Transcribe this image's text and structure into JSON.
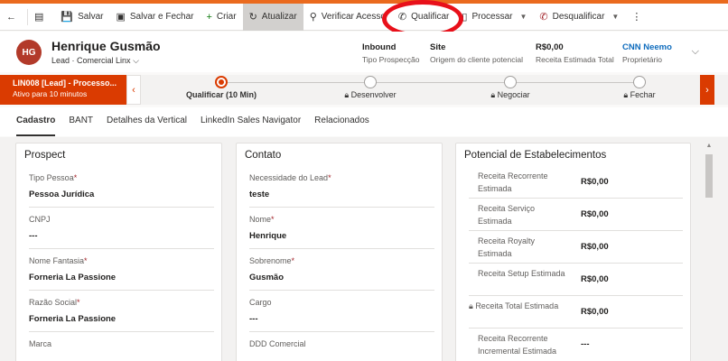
{
  "toolbar": {
    "save": "Salvar",
    "save_close": "Salvar e Fechar",
    "create": "Criar",
    "refresh": "Atualizar",
    "verify_access": "Verificar Acesso",
    "qualify": "Qualificar",
    "process": "Processar",
    "disqualify": "Desqualificar"
  },
  "header": {
    "avatar_initials": "HG",
    "name": "Henrique Gusmão",
    "entity": "Lead",
    "form": "Comercial Linx",
    "fields": [
      {
        "value": "Inbound",
        "label": "Tipo Prospecção"
      },
      {
        "value": "Site",
        "label": "Origem do cliente potencial"
      },
      {
        "value": "R$0,00",
        "label": "Receita Estimada Total"
      },
      {
        "value": "CNN Neemo",
        "label": "Proprietário"
      }
    ]
  },
  "process": {
    "name": "LIN008 [Lead] - Processo...",
    "status": "Ativo para 10 minutos",
    "stages": [
      "Qualificar  (10 Min)",
      "Desenvolver",
      "Negociar",
      "Fechar"
    ]
  },
  "tabs": [
    "Cadastro",
    "BANT",
    "Detalhes da Vertical",
    "LinkedIn Sales Navigator",
    "Relacionados"
  ],
  "prospect": {
    "title": "Prospect",
    "fields": [
      {
        "label": "Tipo Pessoa",
        "required": "*",
        "value": "Pessoa Jurídica"
      },
      {
        "label": "CNPJ",
        "required": "",
        "value": "---"
      },
      {
        "label": "Nome Fantasia",
        "required": "*",
        "value": "Forneria La Passione"
      },
      {
        "label": "Razão Social",
        "required": "*",
        "value": "Forneria La Passione"
      },
      {
        "label": "Marca",
        "required": "",
        "value": ""
      }
    ]
  },
  "contato": {
    "title": "Contato",
    "fields": [
      {
        "label": "Necessidade do Lead",
        "required": "*",
        "value": "teste"
      },
      {
        "label": "Nome",
        "required": "*",
        "value": "Henrique"
      },
      {
        "label": "Sobrenome",
        "required": "*",
        "value": "Gusmão"
      },
      {
        "label": "Cargo",
        "required": "",
        "value": "---"
      },
      {
        "label": "DDD Comercial",
        "required": "",
        "value": ""
      }
    ]
  },
  "potencial": {
    "title": "Potencial de Estabelecimentos",
    "fields": [
      {
        "label": "Receita Recorrente Estimada",
        "value": "R$0,00"
      },
      {
        "label": "Receita Serviço Estimada",
        "value": "R$0,00"
      },
      {
        "label": "Receita Royalty Estimada",
        "value": "R$0,00"
      },
      {
        "label": "Receita Setup Estimada",
        "value": "R$0,00"
      },
      {
        "label": "Receita Total Estimada",
        "value": "R$0,00"
      },
      {
        "label": "Receita Recorrente Incremental Estimada",
        "value": "---"
      }
    ]
  }
}
